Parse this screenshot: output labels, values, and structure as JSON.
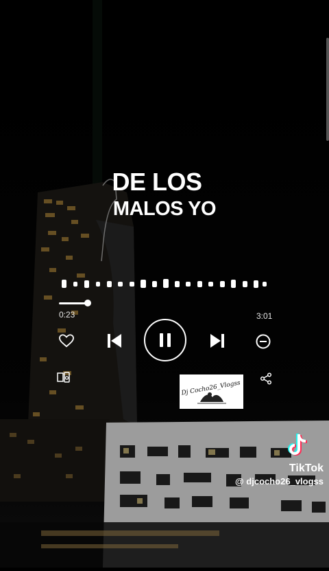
{
  "song": {
    "line1": "DE LOS",
    "line2": "MALOS YO"
  },
  "player": {
    "elapsed": "0:23",
    "total": "3:01",
    "progress": 0.127
  },
  "icons": {
    "like": "heart-icon",
    "prev": "skip-previous-icon",
    "pause": "pause-icon",
    "next": "skip-next-icon",
    "remove": "minus-circle-icon",
    "device": "connect-device-icon",
    "share": "share-icon"
  },
  "watermark": {
    "brand": "TikTok",
    "handle": "@ djcocho26_vlogss"
  },
  "colors": {
    "background": "#000000",
    "foreground": "#ffffff",
    "tiktok_cyan": "#25f4ee",
    "tiktok_red": "#fe2c55"
  }
}
